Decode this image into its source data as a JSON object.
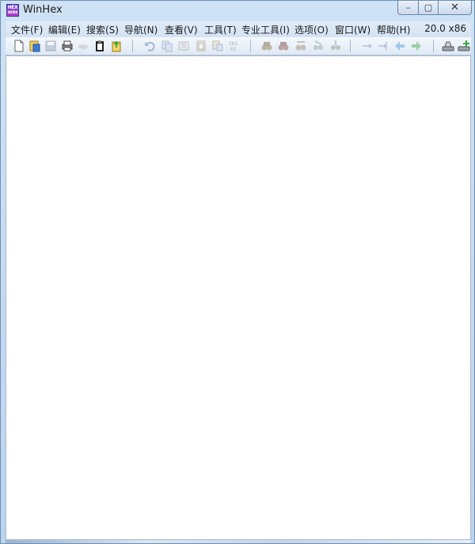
{
  "window": {
    "title": "WinHex",
    "icon": "winhex-icon",
    "icon_text_top": "HEX",
    "icon_text_bottom": "WORK",
    "controls": {
      "minimize": "–",
      "maximize": "▢",
      "close": "✕"
    }
  },
  "menubar": {
    "items": [
      "文件(F)",
      "编辑(E)",
      "搜索(S)",
      "导航(N)",
      "查看(V)",
      "工具(T)",
      "专业工具(I)",
      "选项(O)",
      "窗口(W)",
      "帮助(H)"
    ],
    "version": "20.0 x86"
  },
  "toolbar": {
    "icons": [
      "new-file-icon",
      "open-file-icon",
      "save-icon",
      "print-icon",
      "properties-icon",
      "clipboard-icon",
      "export-icon",
      "undo-icon",
      "copy-icon",
      "cut-icon",
      "paste-icon",
      "paste-special-icon",
      "binary-icon",
      "find-icon",
      "find-hex-icon",
      "replace-icon",
      "replace-hex-icon",
      "find-next-icon",
      "goto-offset-icon",
      "goto-sector-icon",
      "back-icon",
      "forward-icon",
      "open-disk-icon",
      "add-disk-icon"
    ]
  },
  "colors": {
    "frame": "#cfe2f5",
    "menubar": "#d3e2f3",
    "client_bg": "#ffffff"
  }
}
